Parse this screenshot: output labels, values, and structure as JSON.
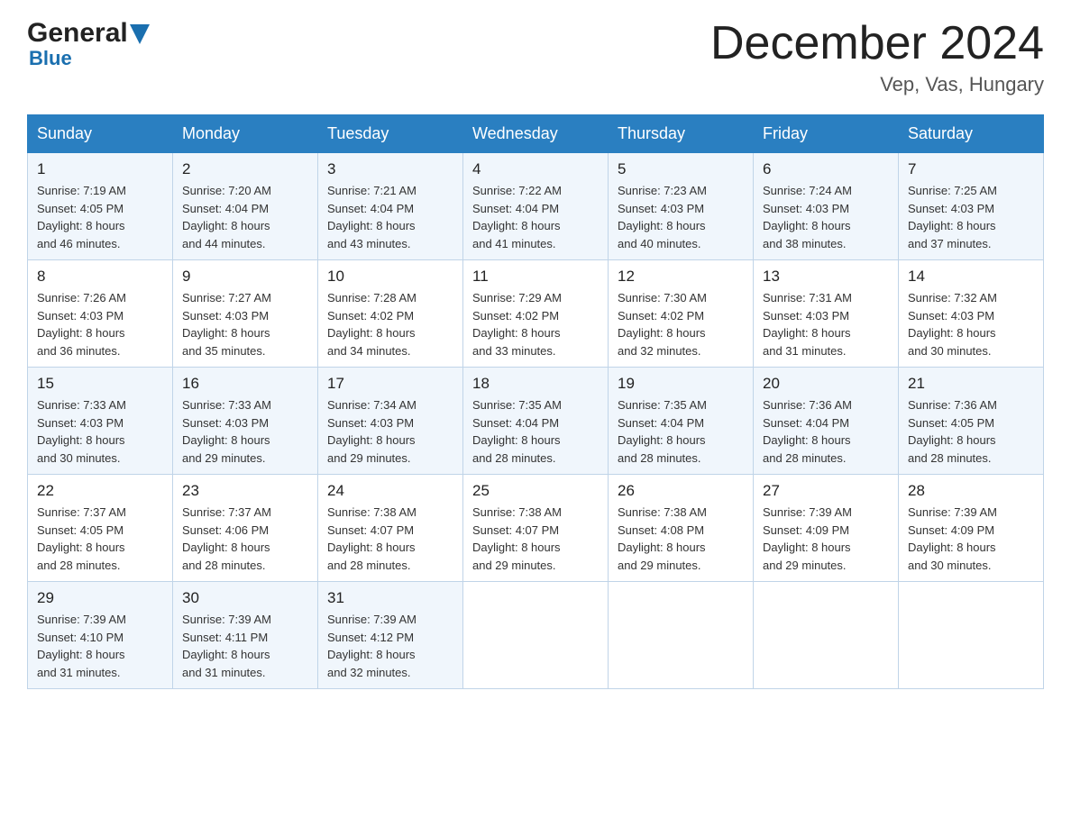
{
  "header": {
    "logo_line1": "General",
    "logo_line2": "Blue",
    "month_title": "December 2024",
    "location": "Vep, Vas, Hungary"
  },
  "days_of_week": [
    "Sunday",
    "Monday",
    "Tuesday",
    "Wednesday",
    "Thursday",
    "Friday",
    "Saturday"
  ],
  "weeks": [
    [
      {
        "day": "1",
        "sunrise": "7:19 AM",
        "sunset": "4:05 PM",
        "daylight": "8 hours and 46 minutes."
      },
      {
        "day": "2",
        "sunrise": "7:20 AM",
        "sunset": "4:04 PM",
        "daylight": "8 hours and 44 minutes."
      },
      {
        "day": "3",
        "sunrise": "7:21 AM",
        "sunset": "4:04 PM",
        "daylight": "8 hours and 43 minutes."
      },
      {
        "day": "4",
        "sunrise": "7:22 AM",
        "sunset": "4:04 PM",
        "daylight": "8 hours and 41 minutes."
      },
      {
        "day": "5",
        "sunrise": "7:23 AM",
        "sunset": "4:03 PM",
        "daylight": "8 hours and 40 minutes."
      },
      {
        "day": "6",
        "sunrise": "7:24 AM",
        "sunset": "4:03 PM",
        "daylight": "8 hours and 38 minutes."
      },
      {
        "day": "7",
        "sunrise": "7:25 AM",
        "sunset": "4:03 PM",
        "daylight": "8 hours and 37 minutes."
      }
    ],
    [
      {
        "day": "8",
        "sunrise": "7:26 AM",
        "sunset": "4:03 PM",
        "daylight": "8 hours and 36 minutes."
      },
      {
        "day": "9",
        "sunrise": "7:27 AM",
        "sunset": "4:03 PM",
        "daylight": "8 hours and 35 minutes."
      },
      {
        "day": "10",
        "sunrise": "7:28 AM",
        "sunset": "4:02 PM",
        "daylight": "8 hours and 34 minutes."
      },
      {
        "day": "11",
        "sunrise": "7:29 AM",
        "sunset": "4:02 PM",
        "daylight": "8 hours and 33 minutes."
      },
      {
        "day": "12",
        "sunrise": "7:30 AM",
        "sunset": "4:02 PM",
        "daylight": "8 hours and 32 minutes."
      },
      {
        "day": "13",
        "sunrise": "7:31 AM",
        "sunset": "4:03 PM",
        "daylight": "8 hours and 31 minutes."
      },
      {
        "day": "14",
        "sunrise": "7:32 AM",
        "sunset": "4:03 PM",
        "daylight": "8 hours and 30 minutes."
      }
    ],
    [
      {
        "day": "15",
        "sunrise": "7:33 AM",
        "sunset": "4:03 PM",
        "daylight": "8 hours and 30 minutes."
      },
      {
        "day": "16",
        "sunrise": "7:33 AM",
        "sunset": "4:03 PM",
        "daylight": "8 hours and 29 minutes."
      },
      {
        "day": "17",
        "sunrise": "7:34 AM",
        "sunset": "4:03 PM",
        "daylight": "8 hours and 29 minutes."
      },
      {
        "day": "18",
        "sunrise": "7:35 AM",
        "sunset": "4:04 PM",
        "daylight": "8 hours and 28 minutes."
      },
      {
        "day": "19",
        "sunrise": "7:35 AM",
        "sunset": "4:04 PM",
        "daylight": "8 hours and 28 minutes."
      },
      {
        "day": "20",
        "sunrise": "7:36 AM",
        "sunset": "4:04 PM",
        "daylight": "8 hours and 28 minutes."
      },
      {
        "day": "21",
        "sunrise": "7:36 AM",
        "sunset": "4:05 PM",
        "daylight": "8 hours and 28 minutes."
      }
    ],
    [
      {
        "day": "22",
        "sunrise": "7:37 AM",
        "sunset": "4:05 PM",
        "daylight": "8 hours and 28 minutes."
      },
      {
        "day": "23",
        "sunrise": "7:37 AM",
        "sunset": "4:06 PM",
        "daylight": "8 hours and 28 minutes."
      },
      {
        "day": "24",
        "sunrise": "7:38 AM",
        "sunset": "4:07 PM",
        "daylight": "8 hours and 28 minutes."
      },
      {
        "day": "25",
        "sunrise": "7:38 AM",
        "sunset": "4:07 PM",
        "daylight": "8 hours and 29 minutes."
      },
      {
        "day": "26",
        "sunrise": "7:38 AM",
        "sunset": "4:08 PM",
        "daylight": "8 hours and 29 minutes."
      },
      {
        "day": "27",
        "sunrise": "7:39 AM",
        "sunset": "4:09 PM",
        "daylight": "8 hours and 29 minutes."
      },
      {
        "day": "28",
        "sunrise": "7:39 AM",
        "sunset": "4:09 PM",
        "daylight": "8 hours and 30 minutes."
      }
    ],
    [
      {
        "day": "29",
        "sunrise": "7:39 AM",
        "sunset": "4:10 PM",
        "daylight": "8 hours and 31 minutes."
      },
      {
        "day": "30",
        "sunrise": "7:39 AM",
        "sunset": "4:11 PM",
        "daylight": "8 hours and 31 minutes."
      },
      {
        "day": "31",
        "sunrise": "7:39 AM",
        "sunset": "4:12 PM",
        "daylight": "8 hours and 32 minutes."
      },
      null,
      null,
      null,
      null
    ]
  ],
  "labels": {
    "sunrise": "Sunrise:",
    "sunset": "Sunset:",
    "daylight": "Daylight:"
  }
}
